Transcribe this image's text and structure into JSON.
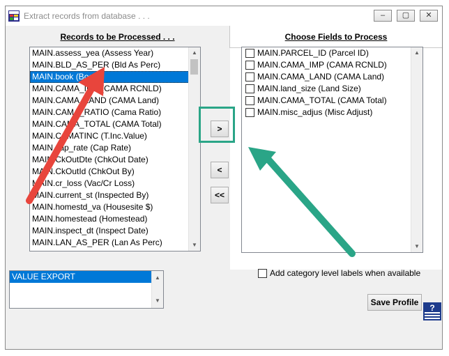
{
  "window": {
    "title": "Extract records from database . . .",
    "controls": [
      "‒",
      "▢",
      "✕"
    ]
  },
  "tabs": {
    "records": "Records to be Processed . . .",
    "fields": "Choose Fields to Process"
  },
  "records_list": {
    "items": [
      "MAIN.assess_yea (Assess Year)",
      "MAIN.BLD_AS_PER (Bld As Perc)",
      "MAIN.book (Book)",
      "MAIN.CAMA_IMP (CAMA RCNLD)",
      "MAIN.CAMA_LAND (CAMA Land)",
      "MAIN.CAMA_RATIO (Cama Ratio)",
      "MAIN.CAMA_TOTAL (CAMA Total)",
      "MAIN.CAMATINC (T.Inc.Value)",
      "MAIN.cap_rate (Cap Rate)",
      "MAIN.CkOutDte (ChkOut Date)",
      "MAIN.CkOutId (ChkOut By)",
      "MAIN.cr_loss (Vac/Cr Loss)",
      "MAIN.current_st (Inspected By)",
      "MAIN.homestd_va (Housesite $)",
      "MAIN.homestead (Homestead)",
      "MAIN.inspect_dt (Inspect Date)",
      "MAIN.LAN_AS_PER (Lan As Perc)"
    ],
    "selected_index": 2
  },
  "fields_list": {
    "items": [
      "MAIN.PARCEL_ID (Parcel ID)",
      "MAIN.CAMA_IMP (CAMA RCNLD)",
      "MAIN.CAMA_LAND (CAMA Land)",
      "MAIN.land_size (Land Size)",
      "MAIN.CAMA_TOTAL (CAMA Total)",
      "MAIN.misc_adjus (Misc Adjust)"
    ]
  },
  "buttons": {
    "add": ">",
    "remove": "<",
    "remove_all": "<<",
    "save_profile": "Save Profile"
  },
  "profile_list": {
    "items": [
      "VALUE EXPORT"
    ]
  },
  "options": {
    "category_labels": "Add category level labels when available",
    "category_labels_checked": false
  },
  "annotations": {
    "arrow_red_color": "#e8453c",
    "arrow_green_color": "#2aa587",
    "highlight_color": "#2aa587"
  }
}
